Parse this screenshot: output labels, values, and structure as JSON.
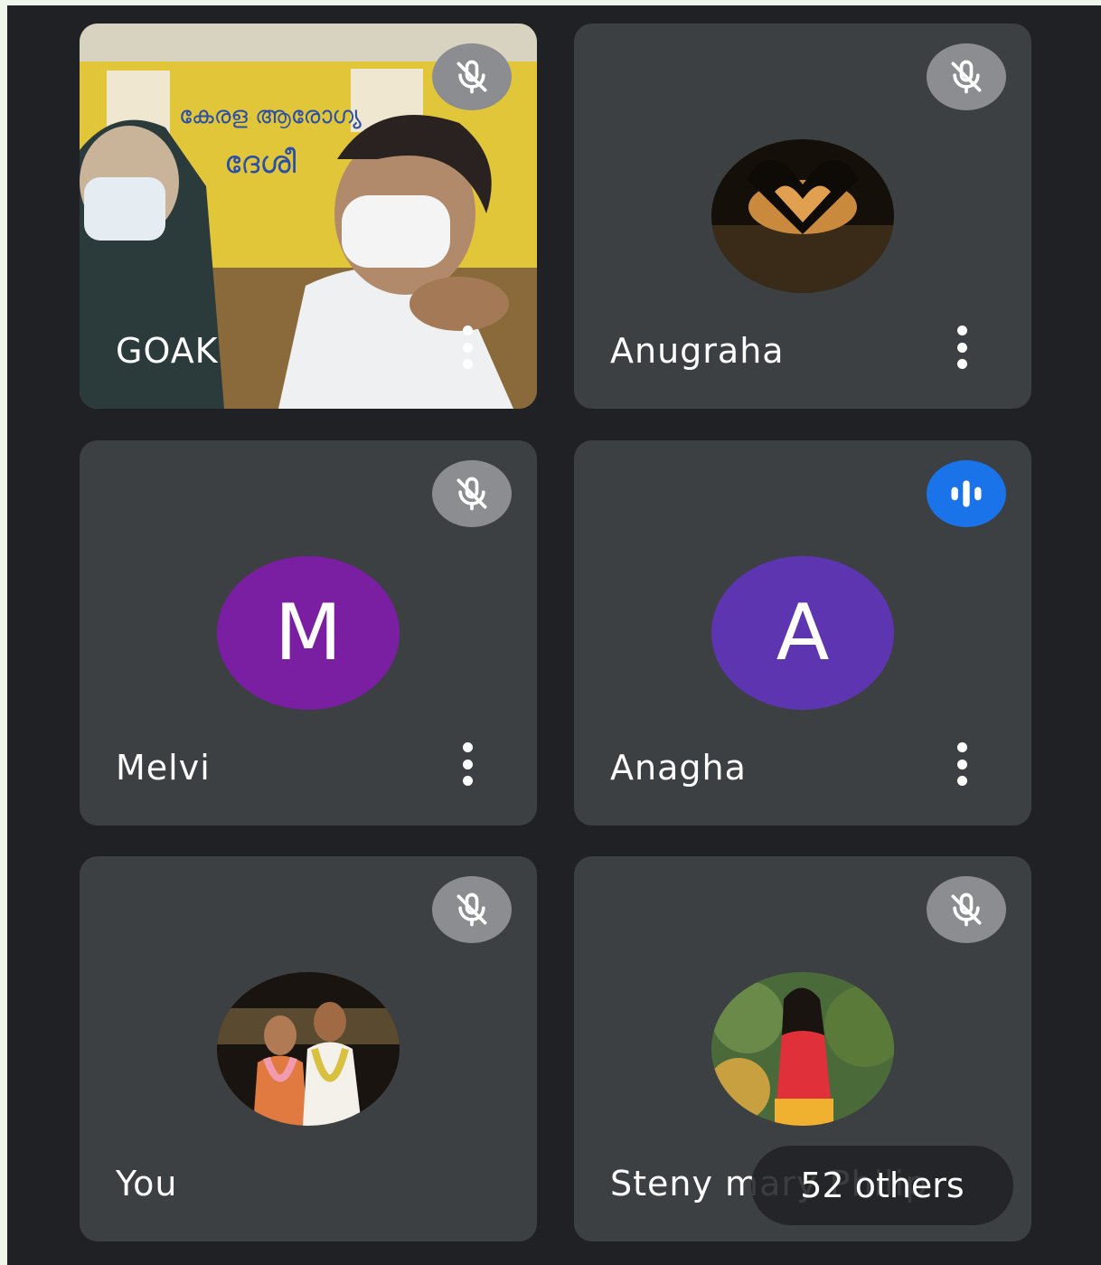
{
  "participants": [
    {
      "name": "GOAK",
      "muted": true
    },
    {
      "name": "Anugraha",
      "muted": true
    },
    {
      "name": "Melvi",
      "muted": true,
      "initial": "M",
      "avatar_color": "#7b1fa2"
    },
    {
      "name": "Anagha",
      "muted": false,
      "speaking": true,
      "initial": "A",
      "avatar_color": "#5e35b1"
    },
    {
      "name": "You",
      "muted": true
    },
    {
      "name": "Steny mary Philip",
      "muted": true
    }
  ],
  "others_label": "52 others",
  "colors": {
    "background": "#202124",
    "tile": "#3c4043",
    "mic_muted_bg": "#8c8d90",
    "speaking_bg": "#1a73e8"
  },
  "icons": {
    "mic_off": "mic-off-icon",
    "speaking": "audio-level-icon",
    "more": "more-vert-icon"
  }
}
